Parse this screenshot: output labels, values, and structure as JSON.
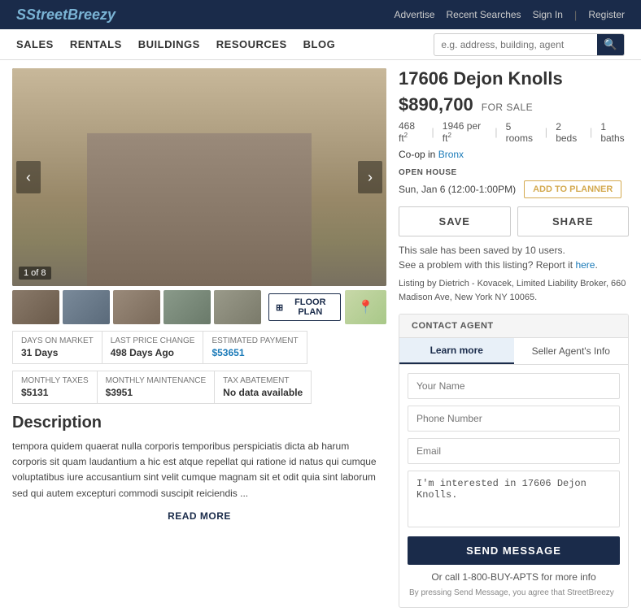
{
  "header": {
    "logo": "StreetBreezy",
    "nav": [
      {
        "label": "Advertise",
        "url": "#"
      },
      {
        "label": "Recent Searches",
        "url": "#"
      },
      {
        "label": "Sign In",
        "url": "#"
      },
      {
        "label": "Register",
        "url": "#"
      }
    ],
    "main_nav": [
      {
        "label": "SALES"
      },
      {
        "label": "RENTALS"
      },
      {
        "label": "BUILDINGS"
      },
      {
        "label": "RESOURCES"
      },
      {
        "label": "BLOG"
      }
    ],
    "search_placeholder": "e.g. address, building, agent"
  },
  "carousel": {
    "counter": "1 of 8",
    "prev_label": "‹",
    "next_label": "›"
  },
  "thumbnails": [
    {
      "alt": "exterior"
    },
    {
      "alt": "interior 1"
    },
    {
      "alt": "interior 2"
    },
    {
      "alt": "interior 3"
    },
    {
      "alt": "interior 4"
    }
  ],
  "floor_plan_label": "FLOOR PLAN",
  "property": {
    "title": "17606 Dejon Knolls",
    "price": "$890,700",
    "sale_type": "FOR SALE",
    "sqft": "468 ft",
    "sqft_sup": "2",
    "per_sqft": "1946 per ft",
    "per_sqft_sup": "2",
    "rooms": "5 rooms",
    "beds": "2 beds",
    "baths": "1 baths",
    "type": "Co-op in",
    "neighborhood": "Bronx",
    "open_house_label": "OPEN HOUSE",
    "open_house_time": "Sun, Jan 6 (12:00-1:00PM)",
    "add_planner": "ADD TO PLANNER",
    "save_label": "SAVE",
    "share_label": "SHARE",
    "saved_info": "This sale has been saved by 10 users.",
    "report_text": "See a problem with this listing? Report it",
    "report_link": "here",
    "listing_info": "Listing by Dietrich - Kovacek, Limited Liability Broker, 660 Madison Ave, New York NY 10065."
  },
  "stats": [
    {
      "label": "DAYS ON MARKET",
      "value": "31 Days"
    },
    {
      "label": "LAST PRICE CHANGE",
      "value": "498 Days Ago"
    },
    {
      "label": "ESTIMATED PAYMENT",
      "value": "$53651"
    }
  ],
  "taxes": [
    {
      "label": "MONTHLY TAXES",
      "value": "$5131"
    },
    {
      "label": "MONTHLY MAINTENANCE",
      "value": "$3951"
    },
    {
      "label": "TAX ABATEMENT",
      "value": "No data available"
    }
  ],
  "description": {
    "title": "Description",
    "text": "tempora quidem quaerat nulla corporis temporibus perspiciatis dicta ab harum corporis sit quam laudantium a hic est atque repellat qui ratione id natus qui cumque voluptatibus iure accusantium sint velit cumque magnam sit et odit quia sint laborum sed qui autem excepturi commodi suscipit reiciendis ...",
    "read_more": "READ MORE"
  },
  "contact": {
    "header": "CONTACT AGENT",
    "tab_learn": "Learn more",
    "tab_seller": "Seller Agent's Info",
    "name_placeholder": "Your Name",
    "phone_placeholder": "Phone Number",
    "email_placeholder": "Email",
    "message_text": "I'm interested in 17606 Dejon Knolls.",
    "send_label": "SEND MESSAGE",
    "or_call": "Or call 1-800-BUY-APTS for more info",
    "by_pressing": "By pressing Send Message, you agree that StreetBreezy"
  }
}
